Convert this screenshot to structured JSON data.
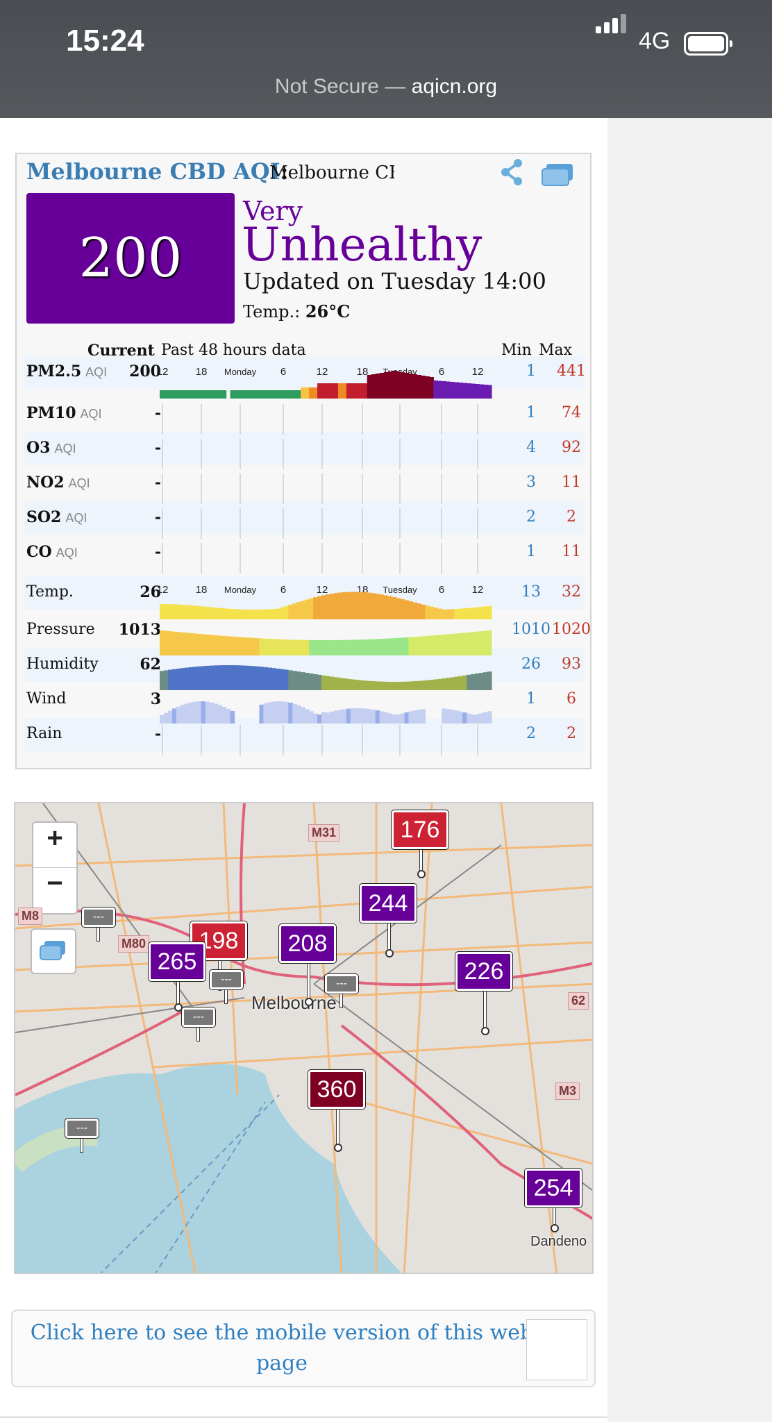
{
  "status_bar": {
    "time": "15:24",
    "network": "4G"
  },
  "browser": {
    "security": "Not Secure — ",
    "domain": "aqicn.org"
  },
  "widget": {
    "title": "Melbourne CBD AQI",
    "colon": ":",
    "subtitle": "Melbourne CBD",
    "aqi": "200",
    "level_line1": "Very",
    "level_line2": "Unhealthy",
    "updated": "Updated on Tuesday 14:00",
    "temp_label": "Temp.:",
    "temp_value": "26°C",
    "header": {
      "current": "Current",
      "past": "Past 48 hours data",
      "min": "Min",
      "max": "Max"
    },
    "time_ticks": [
      "12",
      "18",
      "Monday",
      "6",
      "12",
      "18",
      "Tuesday",
      "6",
      "12"
    ],
    "rows": [
      {
        "name": "PM2.5",
        "unit": "AQI",
        "value": "200",
        "min": "1",
        "max": "441",
        "chart": "pm25"
      },
      {
        "name": "PM10",
        "unit": "AQI",
        "value": "-",
        "min": "1",
        "max": "74",
        "chart": "grid"
      },
      {
        "name": "O3",
        "unit": "AQI",
        "value": "-",
        "min": "4",
        "max": "92",
        "chart": "grid"
      },
      {
        "name": "NO2",
        "unit": "AQI",
        "value": "-",
        "min": "3",
        "max": "11",
        "chart": "grid"
      },
      {
        "name": "SO2",
        "unit": "AQI",
        "value": "-",
        "min": "2",
        "max": "2",
        "chart": "grid"
      },
      {
        "name": "CO",
        "unit": "AQI",
        "value": "-",
        "min": "1",
        "max": "11",
        "chart": "grid"
      },
      {
        "name": "Temp.",
        "unit": "",
        "value": "26",
        "min": "13",
        "max": "32",
        "chart": "temp"
      },
      {
        "name": "Pressure",
        "unit": "",
        "value": "1013",
        "min": "1010",
        "max": "1020",
        "chart": "pressure"
      },
      {
        "name": "Humidity",
        "unit": "",
        "value": "62",
        "min": "26",
        "max": "93",
        "chart": "humidity"
      },
      {
        "name": "Wind",
        "unit": "",
        "value": "3",
        "min": "1",
        "max": "6",
        "chart": "wind"
      },
      {
        "name": "Rain",
        "unit": "",
        "value": "-",
        "min": "2",
        "max": "2",
        "chart": "grid"
      }
    ]
  },
  "map": {
    "zoom_in": "+",
    "zoom_out": "−",
    "city_label": "Melbourne",
    "place_label": "Dandeno",
    "roads": [
      {
        "label": "M31"
      },
      {
        "label": "M8"
      },
      {
        "label": "M80"
      },
      {
        "label": "62"
      },
      {
        "label": "M3"
      }
    ],
    "markers": [
      {
        "value": "176",
        "color": "#cc2233"
      },
      {
        "value": "244",
        "color": "#660099"
      },
      {
        "value": "198",
        "color": "#cc2233"
      },
      {
        "value": "265",
        "color": "#660099"
      },
      {
        "value": "208",
        "color": "#660099"
      },
      {
        "value": "226",
        "color": "#660099"
      },
      {
        "value": "360",
        "color": "#7e0023"
      },
      {
        "value": "254",
        "color": "#660099"
      }
    ],
    "gray_markers": [
      "---",
      "---",
      "---",
      "---",
      "---"
    ]
  },
  "mobile_link": {
    "text": "Click here to see the mobile version of this web page"
  }
}
